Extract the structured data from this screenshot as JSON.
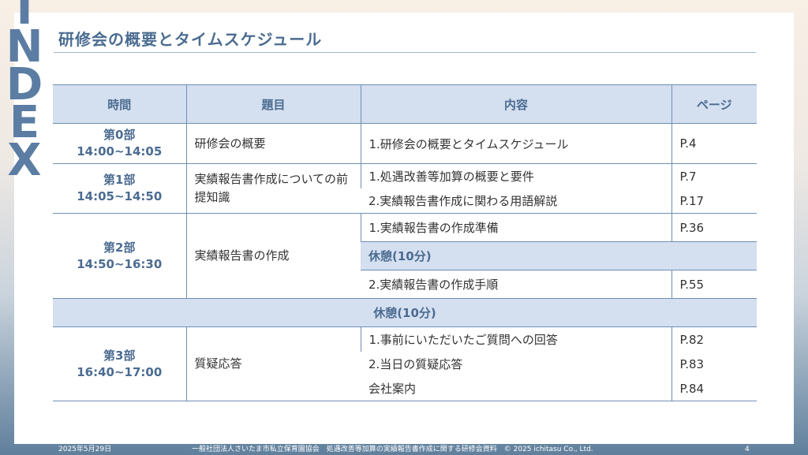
{
  "side_label": [
    "I",
    "N",
    "D",
    "E",
    "X"
  ],
  "title": "研修会の概要とタイムスケジュール",
  "table": {
    "headers": [
      "時間",
      "題目",
      "内容",
      "ページ"
    ],
    "part0": {
      "name": "第0部",
      "time": "14:00~14:05",
      "topic": "研修会の概要",
      "content": "1.研修会の概要とタイムスケジュール",
      "page": "P.4"
    },
    "part1": {
      "name": "第1部",
      "time": "14:05~14:50",
      "topic_lines": [
        "実績報告書作成についての前提知識"
      ],
      "items": [
        {
          "content": "1.処遇改善等加算の概要と要件",
          "page": "P.7"
        },
        {
          "content": "2.実績報告書作成に関わる用語解説",
          "page": "P.17"
        }
      ]
    },
    "part2": {
      "name": "第2部",
      "time": "14:50~16:30",
      "topic": "実績報告書の作成",
      "items": [
        {
          "content": "1.実績報告書の作成準備",
          "page": "P.36"
        },
        {
          "content": "2.実績報告書の作成手順",
          "page": "P.55"
        }
      ],
      "inner_break": "休憩(10分)"
    },
    "break_row": "休憩(10分)",
    "part3": {
      "name": "第3部",
      "time": "16:40~17:00",
      "topic": "質疑応答",
      "items": [
        {
          "content": "1.事前にいただいたご質問への回答",
          "page": "P.82"
        },
        {
          "content": "2.当日の質疑応答",
          "page": "P.83"
        },
        {
          "content": "会社案内",
          "page": "P.84"
        }
      ]
    }
  },
  "footer": {
    "date": "2025年5月29日",
    "org": "一般社団法人さいたま市私立保育園協会　処遇改善等加算の実績報告書作成に関する研修会資料　© 2025 ichitasu Co., Ltd.",
    "page": "4"
  }
}
